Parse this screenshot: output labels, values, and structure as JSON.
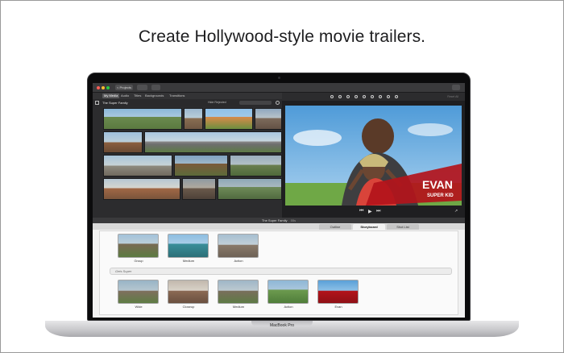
{
  "headline": "Create Hollywood-style movie trailers.",
  "device_label": "MacBook Pro",
  "toolbar": {
    "projects_label": "< Projects"
  },
  "browser": {
    "tabs": [
      "My Media",
      "Audio",
      "Titles",
      "Backgrounds",
      "Transitions"
    ],
    "active_tab": "My Media",
    "event_title": "The Super Family",
    "filter_label": "Hide Rejected"
  },
  "viewer": {
    "reset_label": "Reset All",
    "title_main": "EVAN",
    "title_sub": "SUPER KID"
  },
  "project_title": "The Super Family",
  "project_duration": "55s",
  "trailer_tabs": [
    "Outline",
    "Storyboard",
    "Shot List"
  ],
  "active_trailer_tab": "Storyboard",
  "section_title": "Gets Super",
  "row1_labels": [
    "Group",
    "Medium",
    "Action"
  ],
  "row2_labels": [
    "Wide",
    "Closeup",
    "Medium",
    "Action",
    "Evan"
  ],
  "colors": {
    "accent": "#0a84ff",
    "title_red": "#b3141b",
    "sky": "#6db2e6",
    "grass": "#6fa846"
  }
}
